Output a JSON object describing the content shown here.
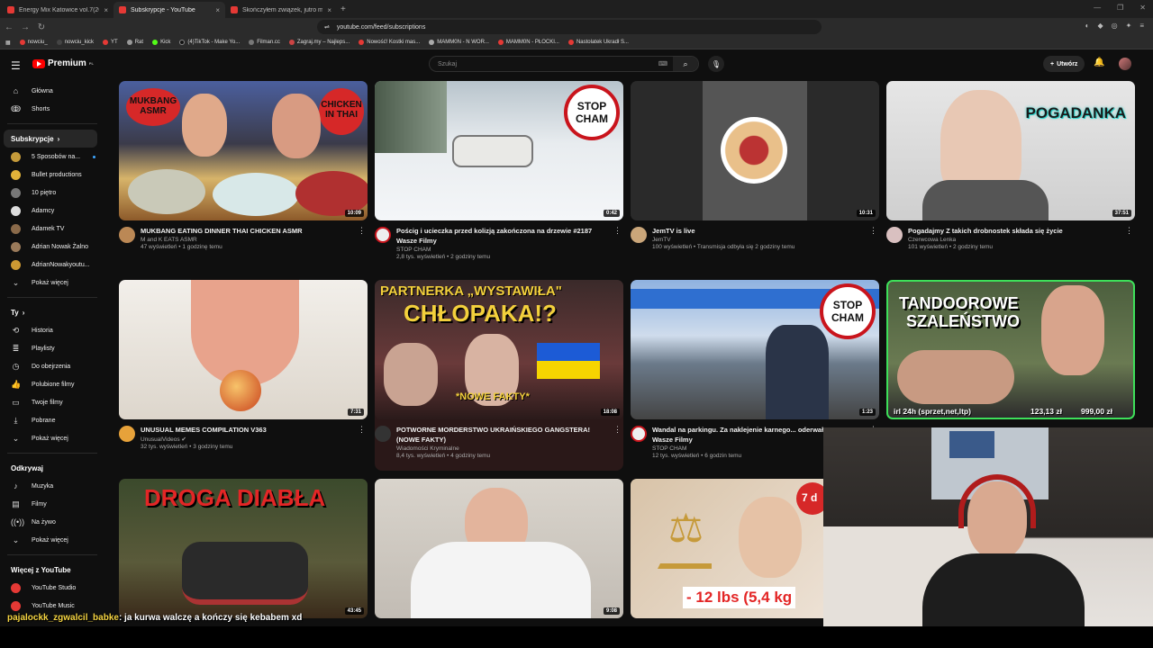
{
  "browser": {
    "tabs": [
      {
        "title": "Energy Mix Katowice vol.7(2017)",
        "active": false
      },
      {
        "title": "Subskrypcje - YouTube",
        "active": true
      },
      {
        "title": "Skończyłem związek, jutro masz się ...",
        "active": false
      }
    ],
    "new_tab": "+",
    "url": "youtube.com/feed/subscriptions",
    "bookmarks": [
      "nowciu_",
      "nowciu_kick",
      "YT",
      "Rat",
      "Kick",
      "(4)TikTok - Make Yo...",
      "Filman.cc",
      "Zagraj.my – Najleps...",
      "Nowość! Kostki mas...",
      "MAMM0N - N WOR...",
      "MAMM0N - PŁOCKI...",
      "Nastolatek Ukradł S..."
    ]
  },
  "youtube": {
    "logo_text": "Premium",
    "logo_badge": "PL",
    "search_placeholder": "Szukaj",
    "create_label": "Utwórz",
    "sidebar": {
      "top": [
        {
          "label": "Główna",
          "icon": "home-icon"
        },
        {
          "label": "Shorts",
          "icon": "shorts-icon"
        }
      ],
      "subs_header": "Subskrypcje",
      "channels": [
        {
          "label": "5 Sposobów na...",
          "color": "#c49a3a",
          "new": true
        },
        {
          "label": "Bullet productions",
          "color": "#e2b33a",
          "new": false
        },
        {
          "label": "10 piętro",
          "color": "#777",
          "new": false
        },
        {
          "label": "Adamcy",
          "color": "#ddd",
          "new": false
        },
        {
          "label": "Adamek TV",
          "color": "#8a6a4a",
          "new": false
        },
        {
          "label": "Adrian Nowak Żalno",
          "color": "#9a7a5a",
          "new": false
        },
        {
          "label": "AdrianNowakyoutu...",
          "color": "#c93",
          "new": false
        }
      ],
      "show_more": "Pokaż więcej",
      "you_header": "Ty",
      "you_items": [
        {
          "label": "Historia",
          "icon": "history-icon"
        },
        {
          "label": "Playlisty",
          "icon": "playlist-icon"
        },
        {
          "label": "Do obejrzenia",
          "icon": "watch-later-icon"
        },
        {
          "label": "Polubione filmy",
          "icon": "like-icon"
        },
        {
          "label": "Twoje filmy",
          "icon": "your-videos-icon"
        },
        {
          "label": "Pobrane",
          "icon": "download-icon"
        },
        {
          "label": "Pokaż więcej",
          "icon": "chevron-down-icon"
        }
      ],
      "explore_header": "Odkrywaj",
      "explore_items": [
        {
          "label": "Muzyka",
          "icon": "music-icon"
        },
        {
          "label": "Filmy",
          "icon": "film-icon"
        },
        {
          "label": "Na żywo",
          "icon": "live-icon"
        },
        {
          "label": "Pokaż więcej",
          "icon": "chevron-down-icon"
        }
      ],
      "more_header": "Więcej z YouTube",
      "more_items": [
        {
          "label": "YouTube Studio",
          "icon": "studio-icon"
        },
        {
          "label": "YouTube Music",
          "icon": "yt-music-icon"
        }
      ]
    },
    "videos": [
      {
        "title": "MUKBANG EATING DINNER THAI CHICKEN ASMR",
        "channel": "M and K EATS ASMR",
        "stats": "47 wyświetleń • 1 godzinę temu",
        "duration": "10:09",
        "thumb": "#5a4a3a",
        "ch_color": "#bb8855",
        "overlay": [
          "MUKBANG ASMR",
          "CHICKEN IN THAI"
        ]
      },
      {
        "title": "Pościg i ucieczka przed kolizją zakończona na drzewie #2187 Wasze Filmy",
        "channel": "STOP CHAM",
        "stats": "2,8 tys. wyświetleń • 2 godziny temu",
        "duration": "0:42",
        "thumb": "#cfd6de",
        "ch_color": "#eeeeee",
        "overlay": [
          "STOP",
          "CHAM"
        ]
      },
      {
        "title": "JemTV is live",
        "channel": "JemTV",
        "stats": "100 wyświetleń • Transmisja odbyła się 2 godziny temu",
        "duration": "10:31",
        "thumb": "#3a3a3a",
        "ch_color": "#caa67a",
        "overlay": []
      },
      {
        "title": "Pogadajmy Z takich drobnostek składa się życie",
        "channel": "Czerwcowa Lenka",
        "stats": "101 wyświetleń • 2 godziny temu",
        "duration": "37:51",
        "thumb": "#d8d8d8",
        "ch_color": "#d9c0c0",
        "overlay": [
          "POGADANKA"
        ]
      },
      {
        "title": "UNUSUAL MEMES COMPILATION V363",
        "channel": "UnusualVideos",
        "stats": "32 tys. wyświetleń • 3 godziny temu",
        "duration": "7:31",
        "thumb": "#e9e4de",
        "ch_color": "#e7a23a",
        "overlay": []
      },
      {
        "title": "POTWORNE MORDERSTWO UKRAIŃSKIEGO GANGSTERA! (NOWE FAKTY)",
        "channel": "Wiadomości Kryminalne",
        "stats": "8,4 tys. wyświetleń • 4 godziny temu",
        "duration": "18:08",
        "thumb": "#5a2a2a",
        "ch_color": "#333333",
        "overlay": [
          "PARTNERKA „WYSTAWIŁA\"",
          "CHŁOPAKA!?",
          "*NOWE FAKTY*"
        ]
      },
      {
        "title": "Wandal na parkingu. Za naklejenie karnego... oderwał ... #2186 Wasze Filmy",
        "channel": "STOP CHAM",
        "stats": "12 tys. wyświetleń • 6 godzin temu",
        "duration": "1:23",
        "thumb": "#7a8ea8",
        "ch_color": "#eeeeee",
        "overlay": [
          "STOP",
          "CHAM"
        ]
      },
      {
        "title": "TANDOOROWE SZALEŃSTWO",
        "channel": "",
        "stats": "",
        "duration": "",
        "thumb": "#5b6b4a",
        "ch_color": "#888888",
        "overlay": [
          "TANDOOROWE",
          "SZALEŃSTWO",
          "irl 24h (sprzet,net,ltp)",
          "123,13 zł",
          "999,00 zł"
        ]
      },
      {
        "title": "DROGA DIABŁA",
        "channel": "",
        "stats": "",
        "duration": "43:45",
        "thumb": "#3a4a2a",
        "ch_color": "#888888",
        "overlay": [
          "DROGA DIABŁA"
        ]
      },
      {
        "title": "",
        "channel": "",
        "stats": "",
        "duration": "9:08",
        "thumb": "#c8c2ba",
        "ch_color": "#888888",
        "overlay": []
      },
      {
        "title": "",
        "channel": "",
        "stats": "",
        "duration": "",
        "thumb": "#d8c8b8",
        "ch_color": "#888888",
        "overlay": [
          "- 12 lbs (5,4 kg",
          "7 d"
        ]
      }
    ]
  },
  "stream": {
    "chat_user": "pajalockk_zgwalcil_babke",
    "chat_message": ": ja kurwa walczę a kończy się kebabem  xd"
  }
}
